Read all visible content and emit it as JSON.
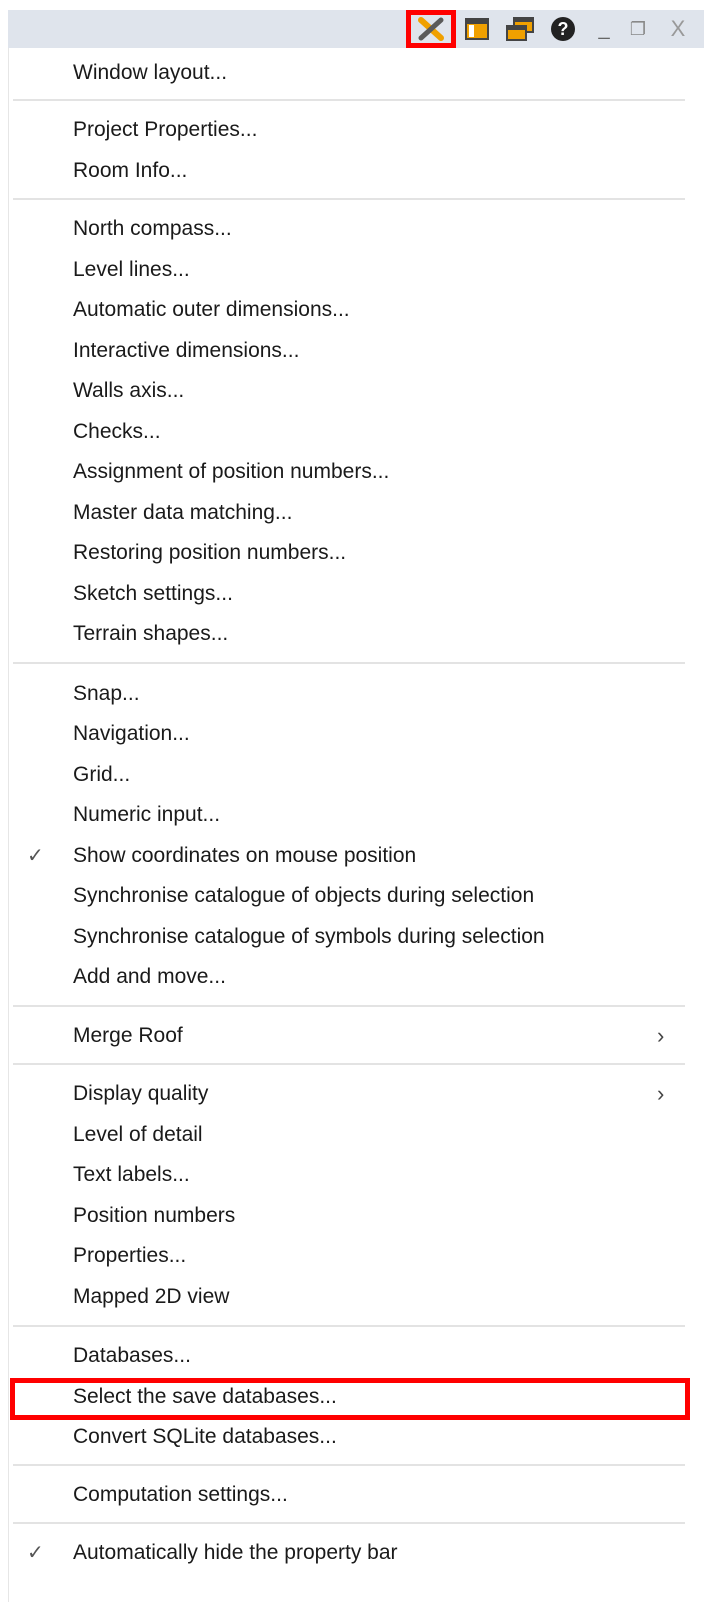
{
  "titlebar": {
    "icons": [
      "tools-icon",
      "panel-icon",
      "windows-icon",
      "help-icon",
      "minimize-icon",
      "restore-icon",
      "close-icon"
    ],
    "minimize_glyph": "_",
    "restore_glyph": "❐",
    "close_glyph": "X",
    "colors": {
      "bar": "#dfe4ec",
      "accent": "#f0a000",
      "highlight": "#ff0000"
    }
  },
  "menu": {
    "window_layout": "Window layout...",
    "project_properties": "Project Properties...",
    "room_info": "Room Info...",
    "north_compass": "North compass...",
    "level_lines": "Level lines...",
    "auto_outer_dims": "Automatic outer dimensions...",
    "interactive_dims": "Interactive dimensions...",
    "walls_axis": "Walls axis...",
    "checks": "Checks...",
    "assign_position_numbers": "Assignment of position numbers...",
    "master_data_matching": "Master data matching...",
    "restoring_position_numbers": "Restoring position numbers...",
    "sketch_settings": "Sketch settings...",
    "terrain_shapes": "Terrain shapes...",
    "snap": "Snap...",
    "navigation": "Navigation...",
    "grid": "Grid...",
    "numeric_input": "Numeric input...",
    "show_coordinates": "Show coordinates on mouse position",
    "sync_objects": "Synchronise catalogue of objects during selection",
    "sync_symbols": "Synchronise catalogue of symbols during selection",
    "add_and_move": "Add and move...",
    "merge_roof": "Merge Roof",
    "display_quality": "Display quality",
    "level_of_detail": "Level of detail",
    "text_labels": "Text labels...",
    "position_numbers": "Position numbers",
    "properties": "Properties...",
    "mapped_2d_view": "Mapped 2D view",
    "databases": "Databases...",
    "select_save_databases": "Select the save databases...",
    "convert_sqlite": "Convert SQLite databases...",
    "computation_settings": "Computation settings...",
    "auto_hide_property_bar": "Automatically hide the property bar",
    "check_glyph": "✓",
    "submenu_glyph": "›"
  }
}
